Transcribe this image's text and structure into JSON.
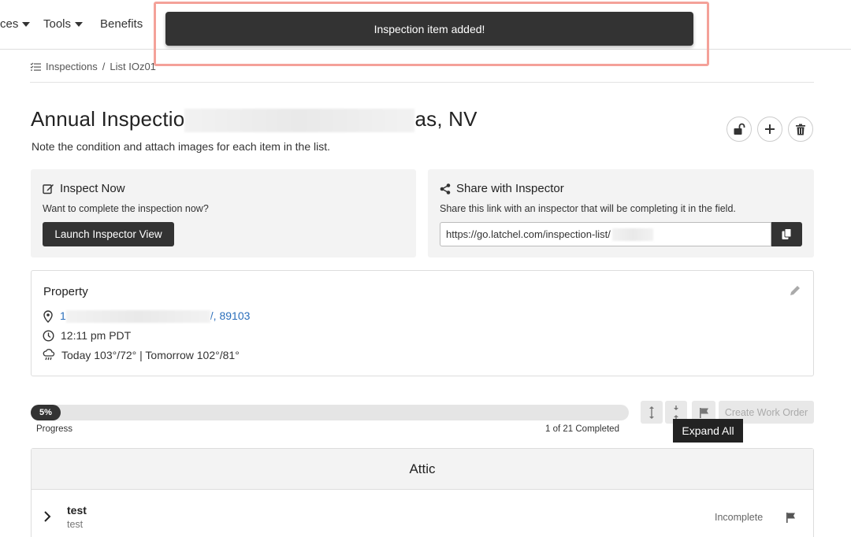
{
  "nav": {
    "items": [
      {
        "label": "ces",
        "has_caret": true
      },
      {
        "label": "Tools",
        "has_caret": true
      },
      {
        "label": "Benefits",
        "has_caret": false
      }
    ]
  },
  "toast": {
    "message": "Inspection item added!"
  },
  "breadcrumb": {
    "root": "Inspections",
    "separator": "/",
    "current": "List IOz01"
  },
  "page": {
    "title_start": "Annual Inspectio",
    "title_end": "as, NV",
    "subtitle": "Note the condition and attach images for each item in the list."
  },
  "actions": {
    "icons": [
      "unlock-icon",
      "plus-icon",
      "trash-icon"
    ]
  },
  "inspect_now": {
    "title": "Inspect Now",
    "text": "Want to complete the inspection now?",
    "button": "Launch Inspector View"
  },
  "share": {
    "title": "Share with Inspector",
    "text": "Share this link with an inspector that will be completing it in the field.",
    "link": "https://go.latchel.com/inspection-list/"
  },
  "property": {
    "title": "Property",
    "address_start": "1",
    "address_end": "/, 89103",
    "time": "12:11 pm PDT",
    "weather": "Today 103°/72° | Tomorrow 102°/81°"
  },
  "progress": {
    "percent_label": "5%",
    "percent": 5,
    "label": "Progress",
    "completed": "1 of 21 Completed"
  },
  "toolbar": {
    "create_work_order": "Create Work Order",
    "tooltip": "Expand All"
  },
  "section": {
    "title": "Attic",
    "items": [
      {
        "name": "test",
        "description": "test",
        "status": "Incomplete"
      }
    ]
  },
  "colors": {
    "accent_dark": "#333333",
    "link": "#2a6ebb",
    "toast_outline": "#f4a199"
  }
}
